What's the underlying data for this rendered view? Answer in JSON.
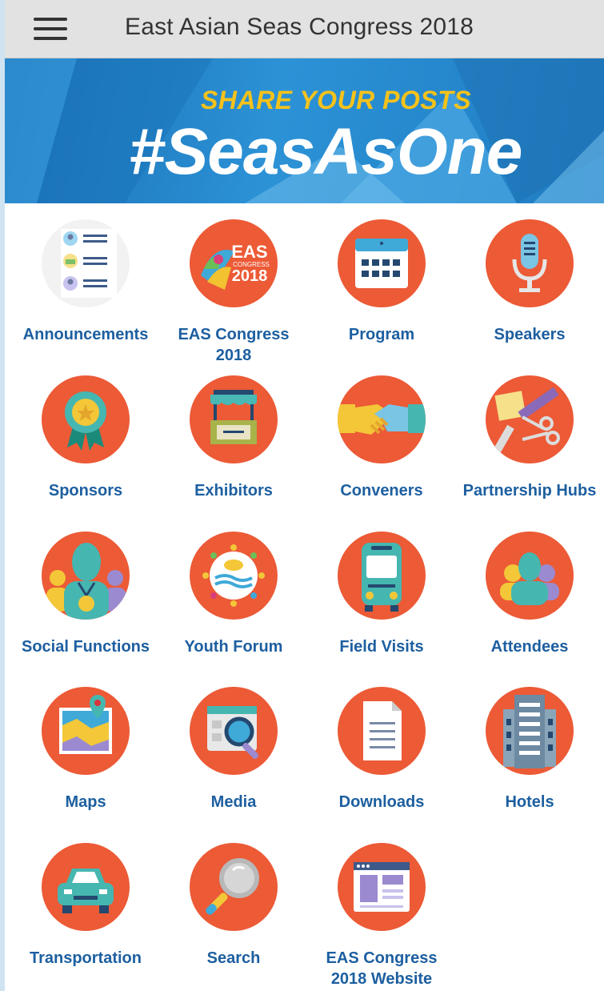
{
  "header": {
    "title": "East Asian Seas Congress 2018",
    "menu_icon": "hamburger-menu-icon"
  },
  "banner": {
    "subtitle": "SHARE YOUR POSTS",
    "hashtag": "#SeasAsOne"
  },
  "badge": {
    "line1": "EAS",
    "line2": "CONGRESS",
    "line3": "2018"
  },
  "colors": {
    "topbar": "#e2e2e2",
    "icon_circle": "#ec5a36",
    "label": "#1d5fa0",
    "banner_blue": "#2c92d6",
    "banner_yellow": "#f6c21b"
  },
  "menu": [
    {
      "label": "Announcements",
      "icon": "announcements-list-icon"
    },
    {
      "label": "EAS Congress 2018",
      "icon": "eas-congress-logo-icon"
    },
    {
      "label": "Program",
      "icon": "calendar-icon"
    },
    {
      "label": "Speakers",
      "icon": "microphone-icon"
    },
    {
      "label": "Sponsors",
      "icon": "award-ribbon-icon"
    },
    {
      "label": "Exhibitors",
      "icon": "booth-stand-icon"
    },
    {
      "label": "Conveners",
      "icon": "handshake-icon"
    },
    {
      "label": "Partnership Hubs",
      "icon": "craft-tools-icon"
    },
    {
      "label": "Social Functions",
      "icon": "people-medal-icon"
    },
    {
      "label": "Youth Forum",
      "icon": "youth-forum-logo-icon"
    },
    {
      "label": "Field Visits",
      "icon": "bus-icon"
    },
    {
      "label": "Attendees",
      "icon": "attendees-group-icon"
    },
    {
      "label": "Maps",
      "icon": "map-pin-icon"
    },
    {
      "label": "Media",
      "icon": "media-magnifier-icon"
    },
    {
      "label": "Downloads",
      "icon": "document-icon"
    },
    {
      "label": "Hotels",
      "icon": "hotel-building-icon"
    },
    {
      "label": "Transportation",
      "icon": "car-icon"
    },
    {
      "label": "Search",
      "icon": "search-icon"
    },
    {
      "label": "EAS Congress 2018  Website",
      "icon": "website-browser-icon"
    }
  ]
}
